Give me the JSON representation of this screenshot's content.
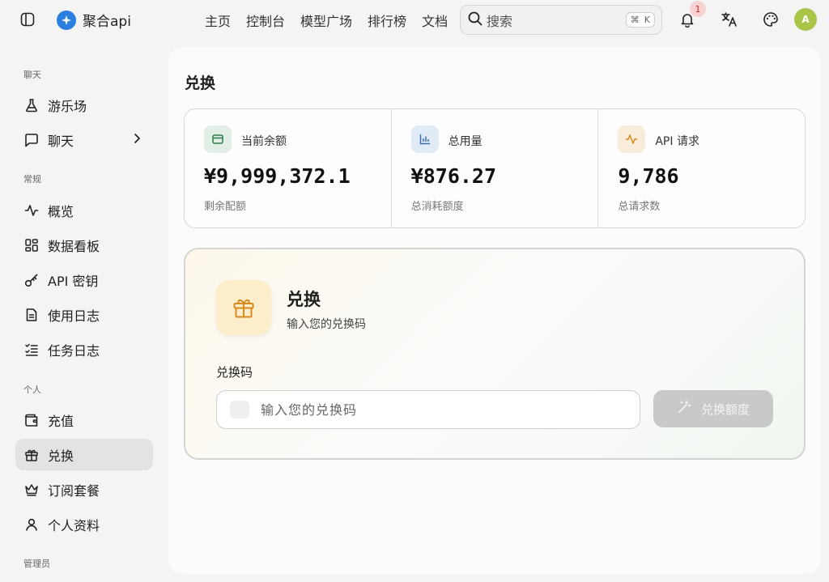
{
  "brand": {
    "name": "聚合api"
  },
  "topnav": [
    "主页",
    "控制台",
    "模型广场",
    "排行榜",
    "文档"
  ],
  "search": {
    "placeholder": "搜索",
    "shortcut_mod": "⌘",
    "shortcut_key": "K"
  },
  "notifications": {
    "count": "1"
  },
  "user": {
    "avatar_letter": "A"
  },
  "sidebar": {
    "sections": [
      "聊天",
      "常规",
      "个人",
      "管理员"
    ],
    "chat": [
      "游乐场",
      "聊天"
    ],
    "general": [
      "概览",
      "数据看板",
      "API 密钥",
      "使用日志",
      "任务日志"
    ],
    "personal": [
      "充值",
      "兑换",
      "订阅套餐",
      "个人资料"
    ]
  },
  "main": {
    "title": "兑换",
    "stats": [
      {
        "label": "当前余额",
        "value": "¥9,999,372.1",
        "sub": "剩余配额"
      },
      {
        "label": "总用量",
        "value": "¥876.27",
        "sub": "总消耗额度"
      },
      {
        "label": "API 请求",
        "value": "9,786",
        "sub": "总请求数"
      }
    ],
    "redeem": {
      "title": "兑换",
      "subtitle": "输入您的兑换码",
      "code_label": "兑换码",
      "placeholder": "输入您的兑换码",
      "button": "兑换额度"
    }
  },
  "colors": {
    "accent_green": "#2e7d4f",
    "accent_blue": "#3a6fb0",
    "accent_orange": "#d98a1e",
    "badge_red": "#d02929",
    "avatar_green": "#a8c548"
  }
}
